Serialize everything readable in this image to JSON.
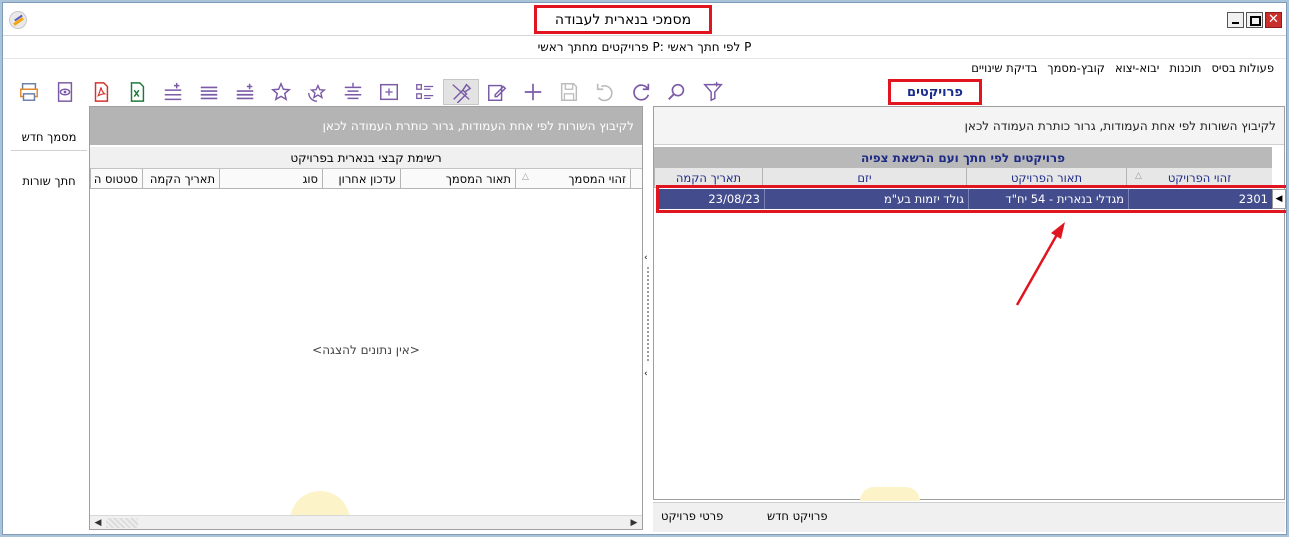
{
  "window": {
    "title": "מסמכי בנארית לעבודה",
    "subtitle": "פרויקטים מחתך ראשי P: לפי חתך ראשי P"
  },
  "menu": {
    "items": [
      "פעולות בסיס",
      "תוכנות",
      "יבוא-יצוא",
      "קובץ-מסמך",
      "בדיקת שינויים"
    ]
  },
  "toolbar": {
    "icons": [
      "printer-icon",
      "preview-icon",
      "pdf-icon",
      "excel-icon",
      "add-row-icon",
      "rows-icon",
      "insert-row-icon",
      "star-icon",
      "undo-star-icon",
      "align-icon",
      "frame-icon",
      "checklist-icon",
      "clear-filter-icon",
      "edit-icon",
      "plus-icon",
      "save-icon",
      "undo-icon",
      "refresh-icon",
      "search-icon",
      "filter-icon"
    ]
  },
  "tabs": {
    "projects": "פרויקטים"
  },
  "side": {
    "new_document": "מסמך חדש",
    "row_slice": "חתך שורות"
  },
  "left_grid": {
    "group_hint": "לקיבוץ השורות לפי אחת העמודות, גרור כותרת העמודה לכאן",
    "title": "רשימת קבצי בנארית בפרויקט",
    "columns": [
      "זהוי המסמך",
      "תאור המסמך",
      "עדכון אחרון",
      "סוג",
      "תאריך הקמה",
      "סטטוס ה"
    ],
    "empty": "<אין נתונים להצגה>"
  },
  "right_grid": {
    "group_hint": "לקיבוץ השורות לפי אחת העמודות, גרור כותרת העמודה לכאן",
    "title": "פרויקטים לפי חתך ועם הרשאת צפיה",
    "columns": [
      "זהוי הפרויקט",
      "תאור הפרויקט",
      "יזם",
      "תאריך הקמה"
    ],
    "rows": [
      {
        "id": "2301",
        "description": "מגדלי בנארית - 54 יח\"ד",
        "developer": "גולד יזמות בע\"מ",
        "created": "23/08/23"
      }
    ]
  },
  "bottom_tabs": {
    "new_project": "פרויקט חדש",
    "project_details": "פרטי פרויקט"
  },
  "colors": {
    "accent": "#1d2a86",
    "selected_row": "#434d8e",
    "highlight": "#e0151f"
  }
}
